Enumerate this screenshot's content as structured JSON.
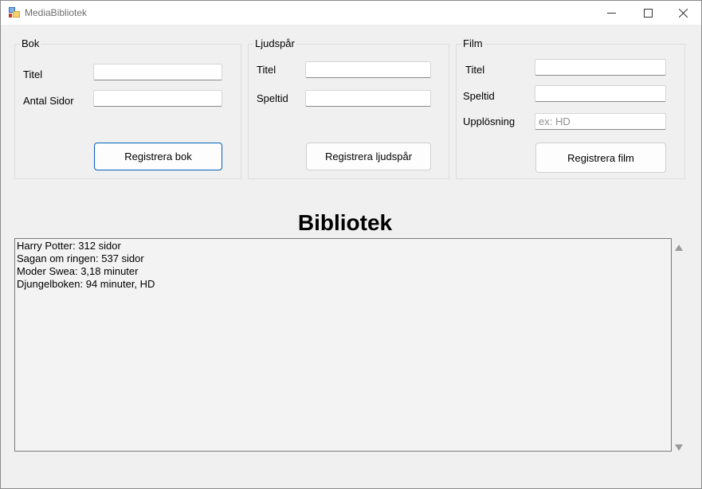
{
  "window": {
    "title": "MediaBibliotek"
  },
  "bok": {
    "legend": "Bok",
    "titel_label": "Titel",
    "titel_value": "",
    "antal_sidor_label": "Antal Sidor",
    "antal_sidor_value": "",
    "register_button": "Registrera bok"
  },
  "ljudspar": {
    "legend": "Ljudspår",
    "titel_label": "Titel",
    "titel_value": "",
    "speltid_label": "Speltid",
    "speltid_value": "",
    "register_button": "Registrera ljudspår"
  },
  "film": {
    "legend": "Film",
    "titel_label": "Titel",
    "titel_value": "",
    "speltid_label": "Speltid",
    "speltid_value": "",
    "upplosning_label": "Upplösning",
    "upplosning_value": "",
    "upplosning_placeholder": "ex: HD",
    "register_button": "Registrera film"
  },
  "bibliotek": {
    "heading": "Bibliotek",
    "items": [
      "Harry Potter: 312 sidor",
      "Sagan om ringen: 537 sidor",
      "Moder Swea: 3,18 minuter",
      "Djungelboken: 94 minuter, HD"
    ]
  },
  "icons": {
    "app": "app-icon",
    "minimize": "minimize-icon",
    "maximize": "maximize-icon",
    "close": "close-icon",
    "scroll_up": "scroll-up-arrow-icon",
    "scroll_down": "scroll-down-arrow-icon"
  },
  "colors": {
    "window_bg": "#f0f0f0",
    "titlebar_bg": "#ffffff",
    "accent_border": "#005fb8",
    "listbox_bg": "#f3f3f3"
  }
}
